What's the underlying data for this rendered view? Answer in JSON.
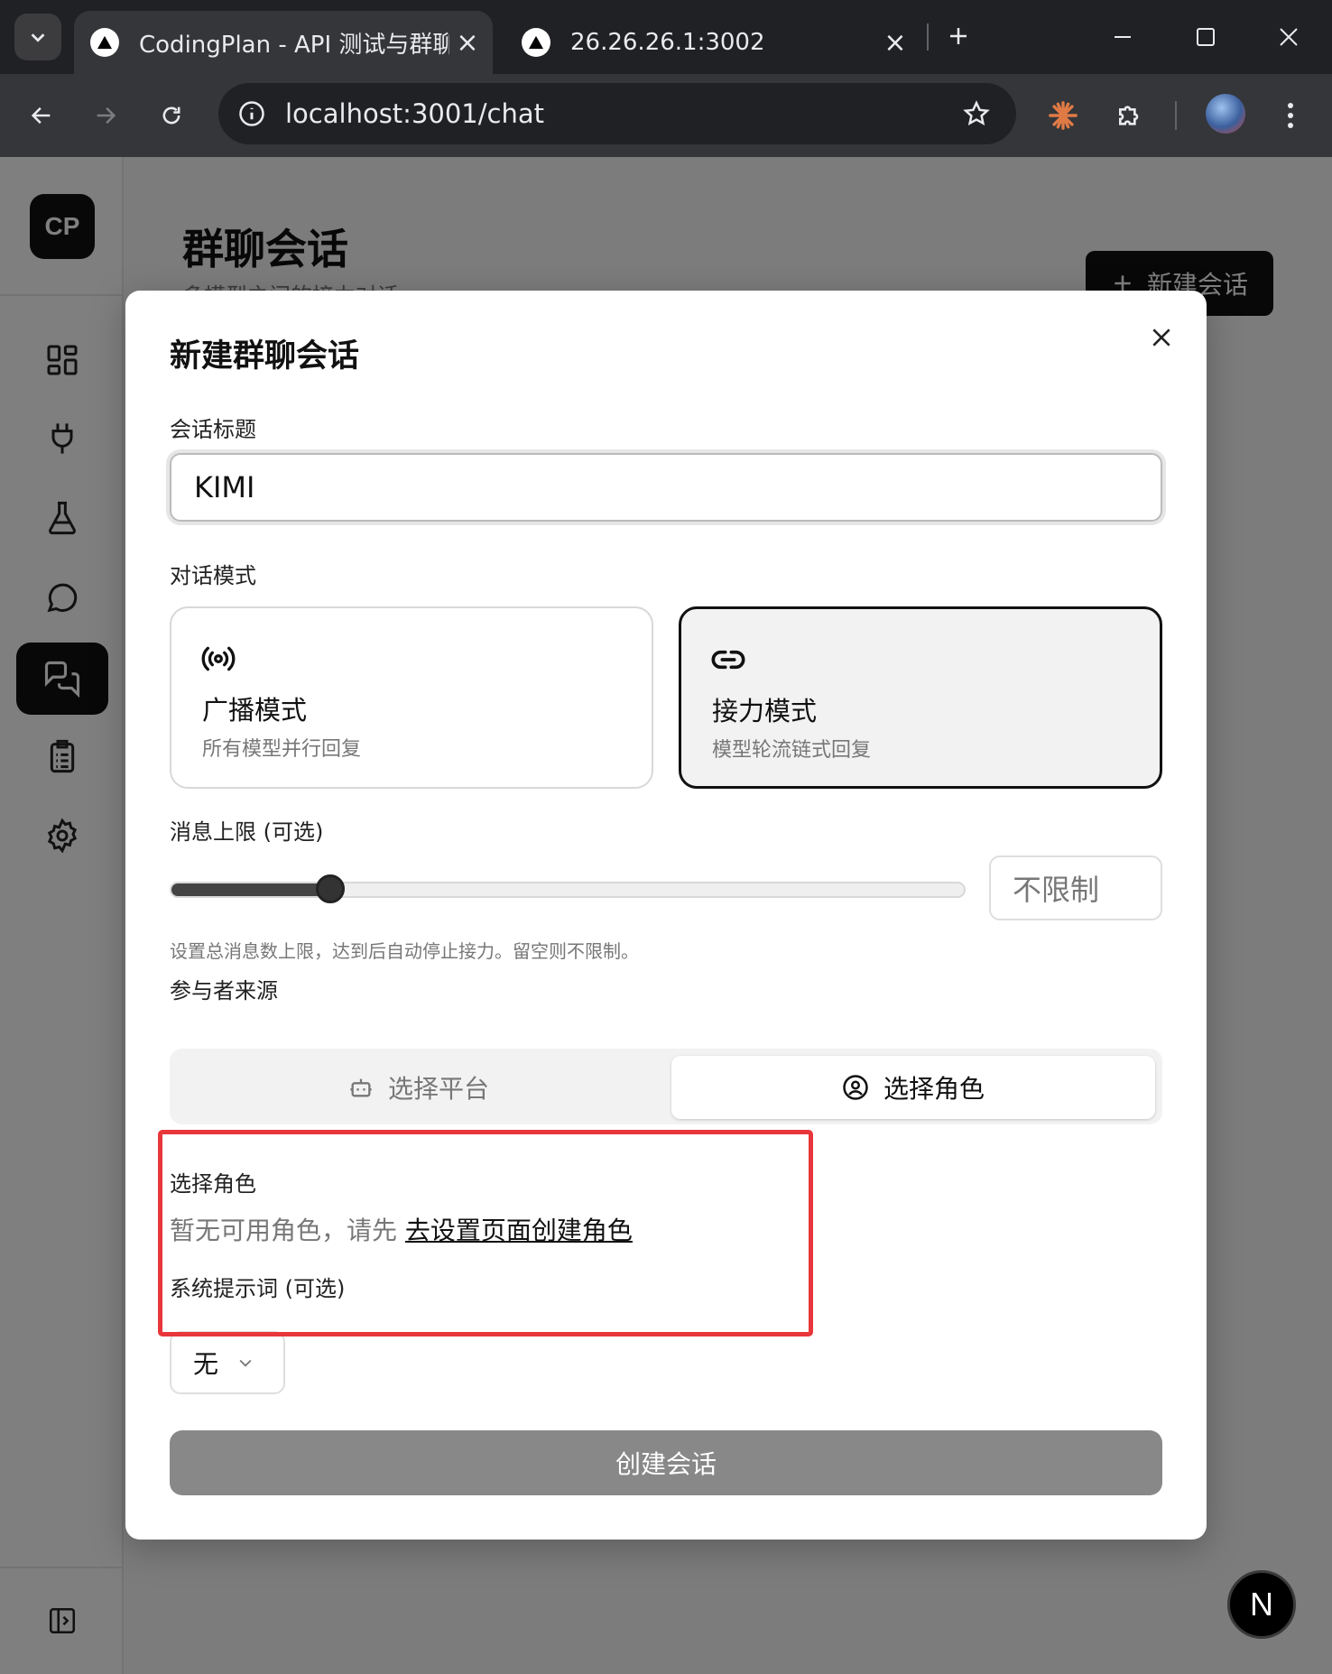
{
  "browser": {
    "tabs": [
      {
        "title": "CodingPlan - API 测试与群聊系统",
        "active": true
      },
      {
        "title": "26.26.26.1:3002",
        "active": false
      }
    ],
    "url": "localhost:3001/chat"
  },
  "sidebar": {
    "logo": "CP",
    "items": [
      {
        "icon": "dashboard-icon"
      },
      {
        "icon": "plug-icon"
      },
      {
        "icon": "flask-icon"
      },
      {
        "icon": "chat-bubble-icon"
      },
      {
        "icon": "group-chat-icon",
        "active": true
      },
      {
        "icon": "clipboard-icon"
      },
      {
        "icon": "gear-icon"
      }
    ]
  },
  "page": {
    "title": "群聊会话",
    "subtitle": "多模型之间的接力对话",
    "new_button": "新建会话"
  },
  "modal": {
    "title": "新建群聊会话",
    "title_label": "会话标题",
    "title_value": "KIMI",
    "mode_label": "对话模式",
    "modes": [
      {
        "title": "广播模式",
        "desc": "所有模型并行回复",
        "icon": "broadcast-icon",
        "selected": false
      },
      {
        "title": "接力模式",
        "desc": "模型轮流链式回复",
        "icon": "link-icon",
        "selected": true
      }
    ],
    "limit_label": "消息上限 (可选)",
    "limit_slider_fraction": 0.2,
    "limit_placeholder": "不限制",
    "limit_help": "设置总消息数上限，达到后自动停止接力。留空则不限制。",
    "source_label": "参与者来源",
    "source_tabs": [
      {
        "label": "选择平台",
        "icon": "bot-icon",
        "active": false
      },
      {
        "label": "选择角色",
        "icon": "user-circle-icon",
        "active": true
      }
    ],
    "role_label": "选择角色",
    "empty_text": "暂无可用角色，请先",
    "empty_link": "去设置页面创建角色",
    "system_prompt_label": "系统提示词 (可选)",
    "system_prompt_value": "无",
    "create_button": "创建会话"
  },
  "next_badge": "N",
  "colors": {
    "accent": "#111111",
    "highlight": "#e8363a",
    "button_disabled": "#888888"
  }
}
